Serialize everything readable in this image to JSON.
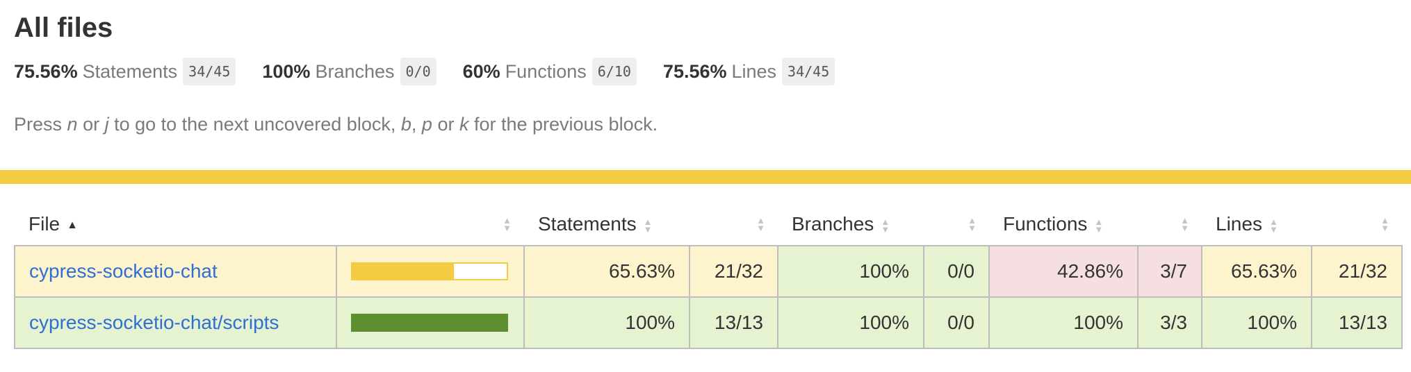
{
  "page": {
    "title": "All files",
    "hint": {
      "p1": "Press ",
      "k1": "n",
      "p2": " or ",
      "k2": "j",
      "p3": " to go to the next uncovered block, ",
      "k3": "b",
      "p4": ", ",
      "k4": "p",
      "p5": " or ",
      "k5": "k",
      "p6": " for the previous block."
    }
  },
  "summary": [
    {
      "pct": "75.56%",
      "label": "Statements",
      "frac": "34/45"
    },
    {
      "pct": "100%",
      "label": "Branches",
      "frac": "0/0"
    },
    {
      "pct": "60%",
      "label": "Functions",
      "frac": "6/10"
    },
    {
      "pct": "75.56%",
      "label": "Lines",
      "frac": "34/45"
    }
  ],
  "colors": {
    "medium": "#f4cc44",
    "high": "#5d8f31",
    "low_bg": "#f6dfe3",
    "link": "#2f6fd4"
  },
  "table": {
    "headers": {
      "file": "File",
      "statements": "Statements",
      "branches": "Branches",
      "functions": "Functions",
      "lines": "Lines"
    },
    "rows": [
      {
        "file": "cypress-socketio-chat",
        "coverage_fraction": 0.6563,
        "statements_pct": "65.63%",
        "statements_frac": "21/32",
        "branches_pct": "100%",
        "branches_frac": "0/0",
        "functions_pct": "42.86%",
        "functions_frac": "3/7",
        "lines_pct": "65.63%",
        "lines_frac": "21/32"
      },
      {
        "file": "cypress-socketio-chat/scripts",
        "coverage_fraction": 1.0,
        "statements_pct": "100%",
        "statements_frac": "13/13",
        "branches_pct": "100%",
        "branches_frac": "0/0",
        "functions_pct": "100%",
        "functions_frac": "3/3",
        "lines_pct": "100%",
        "lines_frac": "13/13"
      }
    ]
  }
}
